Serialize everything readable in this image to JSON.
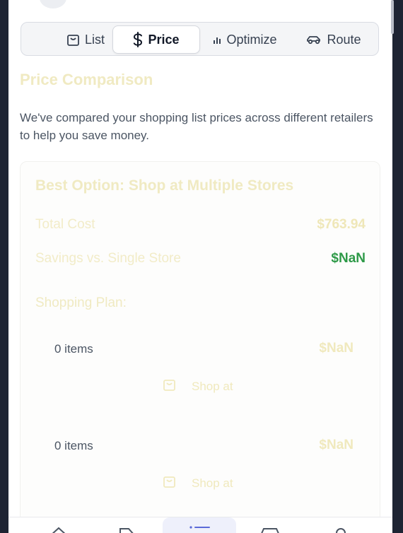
{
  "tabs": [
    {
      "label": "List",
      "icon": "shopping-bag-icon",
      "active": false
    },
    {
      "label": "Price",
      "icon": "dollar-icon",
      "active": true
    },
    {
      "label": "Optimize",
      "icon": "bar-chart-icon",
      "active": false
    },
    {
      "label": "Route",
      "icon": "car-icon",
      "active": false
    }
  ],
  "page": {
    "title": "Price Comparison",
    "description": "We've compared your shopping list prices across different retailers to help you save money."
  },
  "best_option": {
    "title": "Best Option: Shop at Multiple Stores",
    "total_cost_label": "Total Cost",
    "total_cost_value": "$763.94",
    "savings_label": "Savings vs. Single Store",
    "savings_value": "$NaN",
    "plan_title": "Shopping Plan:"
  },
  "stores": [
    {
      "items": "0 items",
      "price": "$NaN",
      "shop_label": "Shop at"
    },
    {
      "items": "0 items",
      "price": "$NaN",
      "shop_label": "Shop at"
    }
  ],
  "bottom_nav": [
    "home-icon",
    "tag-icon",
    "list-icon",
    "store-icon",
    "user-icon"
  ],
  "colors": {
    "accent_green": "#2e9a48",
    "faded_text": "#f0eac2",
    "nav_active_bg": "#eef0fb"
  }
}
